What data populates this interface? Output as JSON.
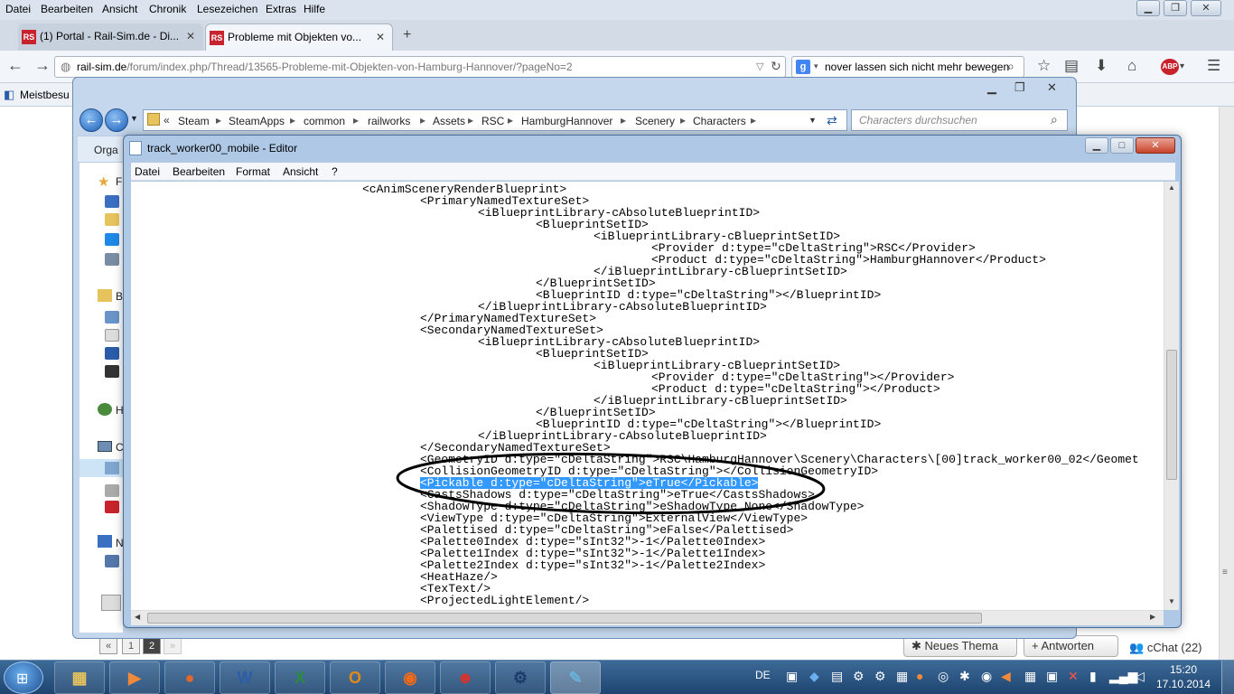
{
  "firefox": {
    "menu": [
      "Datei",
      "Bearbeiten",
      "Ansicht",
      "Chronik",
      "Lesezeichen",
      "Extras",
      "Hilfe"
    ],
    "tabs": [
      {
        "label": "(1) Portal - Rail-Sim.de - Di..."
      },
      {
        "label": "Probleme mit Objekten vo..."
      }
    ],
    "url_host": "rail-sim.de",
    "url_path": "/forum/index.php/Thread/13565-Probleme-mit-Objekten-von-Hamburg-Hannover/?pageNo=2",
    "search_value": "nover lassen sich nicht mehr bewegen",
    "bookmarks_label": "Meistbesu",
    "abp_label": "ABP"
  },
  "explorer": {
    "breadcrumb": [
      "Steam",
      "SteamApps",
      "common",
      "railworks",
      "Assets",
      "RSC",
      "HamburgHannover",
      "Scenery",
      "Characters"
    ],
    "search_placeholder": "Characters durchsuchen",
    "toolbar_label": "Orga",
    "side_letters": [
      "F",
      "B",
      "H",
      "C",
      "N"
    ]
  },
  "notepad": {
    "title": "track_worker00_mobile - Editor",
    "menu": [
      "Datei",
      "Bearbeiten",
      "Format",
      "Ansicht",
      "?"
    ],
    "lines": [
      {
        "indent": 0,
        "text": "<cAnimSceneryRenderBlueprint>"
      },
      {
        "indent": 1,
        "text": "<PrimaryNamedTextureSet>"
      },
      {
        "indent": 2,
        "text": "<iBlueprintLibrary-cAbsoluteBlueprintID>"
      },
      {
        "indent": 3,
        "text": "<BlueprintSetID>"
      },
      {
        "indent": 4,
        "text": "<iBlueprintLibrary-cBlueprintSetID>"
      },
      {
        "indent": 5,
        "text": "<Provider d:type=\"cDeltaString\">RSC</Provider>"
      },
      {
        "indent": 5,
        "text": "<Product d:type=\"cDeltaString\">HamburgHannover</Product>"
      },
      {
        "indent": 4,
        "text": "</iBlueprintLibrary-cBlueprintSetID>"
      },
      {
        "indent": 3,
        "text": "</BlueprintSetID>"
      },
      {
        "indent": 3,
        "text": "<BlueprintID d:type=\"cDeltaString\"></BlueprintID>"
      },
      {
        "indent": 2,
        "text": "</iBlueprintLibrary-cAbsoluteBlueprintID>"
      },
      {
        "indent": 1,
        "text": "</PrimaryNamedTextureSet>"
      },
      {
        "indent": 1,
        "text": "<SecondaryNamedTextureSet>"
      },
      {
        "indent": 2,
        "text": "<iBlueprintLibrary-cAbsoluteBlueprintID>"
      },
      {
        "indent": 3,
        "text": "<BlueprintSetID>"
      },
      {
        "indent": 4,
        "text": "<iBlueprintLibrary-cBlueprintSetID>"
      },
      {
        "indent": 5,
        "text": "<Provider d:type=\"cDeltaString\"></Provider>"
      },
      {
        "indent": 5,
        "text": "<Product d:type=\"cDeltaString\"></Product>"
      },
      {
        "indent": 4,
        "text": "</iBlueprintLibrary-cBlueprintSetID>"
      },
      {
        "indent": 3,
        "text": "</BlueprintSetID>"
      },
      {
        "indent": 3,
        "text": "<BlueprintID d:type=\"cDeltaString\"></BlueprintID>"
      },
      {
        "indent": 2,
        "text": "</iBlueprintLibrary-cAbsoluteBlueprintID>"
      },
      {
        "indent": 1,
        "text": "</SecondaryNamedTextureSet>"
      },
      {
        "indent": 1,
        "text": "<GeometryID d:type=\"cDeltaString\">RSC\\HamburgHannover\\Scenery\\Characters\\[00]track_worker00_02</Geomet"
      },
      {
        "indent": 1,
        "text": "<CollisionGeometryID d:type=\"cDeltaString\"></CollisionGeometryID>"
      },
      {
        "indent": 1,
        "text": "<Pickable d:type=\"cDeltaString\">eTrue</Pickable>",
        "selected": true
      },
      {
        "indent": 1,
        "text": "<CastsShadows d:type=\"cDeltaString\">eTrue</CastsShadows>"
      },
      {
        "indent": 1,
        "text": "<ShadowType d:type=\"cDeltaString\">eShadowType_None</ShadowType>"
      },
      {
        "indent": 1,
        "text": "<ViewType d:type=\"cDeltaString\">ExternalView</ViewType>"
      },
      {
        "indent": 1,
        "text": "<Palettised d:type=\"cDeltaString\">eFalse</Palettised>"
      },
      {
        "indent": 1,
        "text": "<Palette0Index d:type=\"sInt32\">-1</Palette0Index>"
      },
      {
        "indent": 1,
        "text": "<Palette1Index d:type=\"sInt32\">-1</Palette1Index>"
      },
      {
        "indent": 1,
        "text": "<Palette2Index d:type=\"sInt32\">-1</Palette2Index>"
      },
      {
        "indent": 1,
        "text": "<HeatHaze/>"
      },
      {
        "indent": 1,
        "text": "<TexText/>"
      },
      {
        "indent": 1,
        "text": "<ProjectedLightElement/>"
      }
    ]
  },
  "forum": {
    "pages": [
      "«",
      "1",
      "2",
      "»"
    ],
    "new_topic": "Neues Thema",
    "reply": "Antworten",
    "chat": "cChat (22)"
  },
  "taskbar": {
    "language": "DE",
    "time": "15:20",
    "date": "17.10.2014",
    "items": [
      {
        "name": "explorer",
        "glyph": "▦"
      },
      {
        "name": "media-player",
        "glyph": "▶"
      },
      {
        "name": "firefox",
        "glyph": "●"
      },
      {
        "name": "word",
        "glyph": "W"
      },
      {
        "name": "excel",
        "glyph": "X"
      },
      {
        "name": "outlook",
        "glyph": "O"
      },
      {
        "name": "app-orange",
        "glyph": "◉"
      },
      {
        "name": "app-red",
        "glyph": "☻"
      },
      {
        "name": "steam",
        "glyph": "⚙"
      },
      {
        "name": "notepad",
        "glyph": "✎"
      }
    ]
  },
  "colors": {
    "selection": "#3399ff",
    "ellipse": "#000000"
  }
}
